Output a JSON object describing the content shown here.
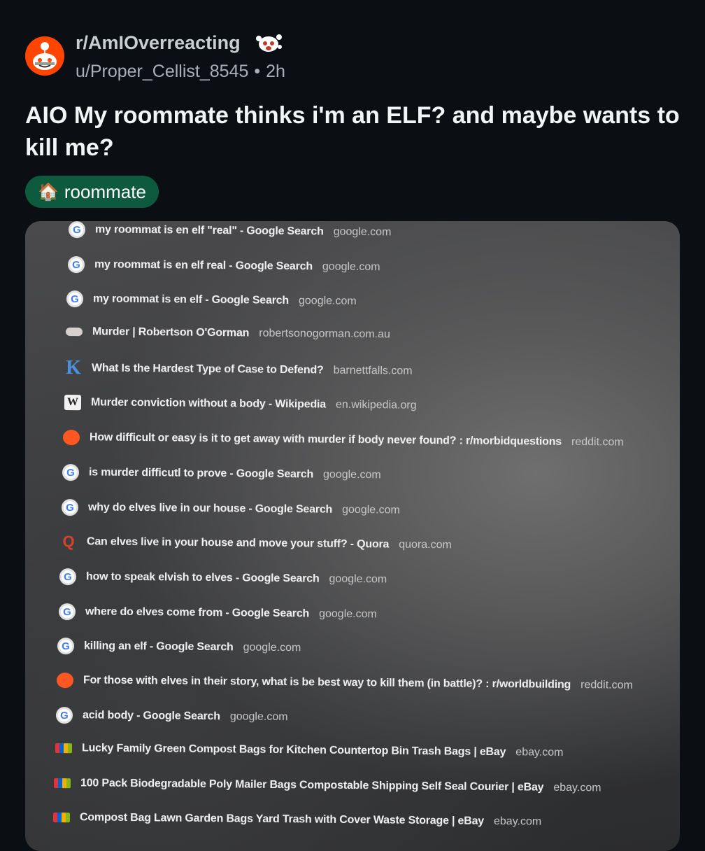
{
  "post": {
    "subreddit": "r/AmIOverreacting",
    "username": "u/Proper_Cellist_8545",
    "separator": "•",
    "age": "2h",
    "title": "AIO My roommate thinks i'm an ELF? and maybe wants to kill me?",
    "flair": {
      "emoji": "🏠",
      "label": "roommate"
    }
  },
  "colors": {
    "background": "#0b0f14",
    "flair_bg": "#0e5a3f",
    "avatar": "#ff4500"
  },
  "history": [
    {
      "icon": "google-icon",
      "title": "my roommat is en elf \"real\" - Google Search",
      "domain": "google.com"
    },
    {
      "icon": "google-icon",
      "title": "my roommat is en elf real - Google Search",
      "domain": "google.com"
    },
    {
      "icon": "google-icon",
      "title": "my roommat is en elf - Google Search",
      "domain": "google.com"
    },
    {
      "icon": "site-icon",
      "title": "Murder | Robertson O'Gorman",
      "domain": "robertsonogorman.com.au"
    },
    {
      "icon": "k-icon",
      "title": "What Is the Hardest Type of Case to Defend?",
      "domain": "barnettfalls.com"
    },
    {
      "icon": "wikipedia-icon",
      "title": "Murder conviction without a body - Wikipedia",
      "domain": "en.wikipedia.org"
    },
    {
      "icon": "reddit-icon",
      "title": "How difficult or easy is it to get away with murder if body never found? : r/morbidquestions",
      "domain": "reddit.com"
    },
    {
      "icon": "google-icon",
      "title": "is murder difficutl to prove - Google Search",
      "domain": "google.com"
    },
    {
      "icon": "google-icon",
      "title": "why do elves live in our house - Google Search",
      "domain": "google.com"
    },
    {
      "icon": "quora-icon",
      "title": "Can elves live in your house and move your stuff? - Quora",
      "domain": "quora.com"
    },
    {
      "icon": "google-icon",
      "title": "how to speak elvish to elves - Google Search",
      "domain": "google.com"
    },
    {
      "icon": "google-icon",
      "title": "where do elves come from - Google Search",
      "domain": "google.com"
    },
    {
      "icon": "google-icon",
      "title": "killing an elf - Google Search",
      "domain": "google.com"
    },
    {
      "icon": "reddit-icon",
      "title": "For those with elves in their story, what is be best way to kill them (in battle)? : r/worldbuilding",
      "domain": "reddit.com"
    },
    {
      "icon": "google-icon",
      "title": "acid body - Google Search",
      "domain": "google.com"
    },
    {
      "icon": "ebay-icon",
      "title": "Lucky Family Green Compost Bags for Kitchen Countertop Bin Trash Bags | eBay",
      "domain": "ebay.com"
    },
    {
      "icon": "ebay-icon",
      "title": "100 Pack Biodegradable Poly Mailer Bags Compostable Shipping Self Seal Courier | eBay",
      "domain": "ebay.com"
    },
    {
      "icon": "ebay-icon",
      "title": "Compost Bag Lawn Garden Bags Yard Trash with Cover Waste Storage | eBay",
      "domain": "ebay.com"
    }
  ]
}
